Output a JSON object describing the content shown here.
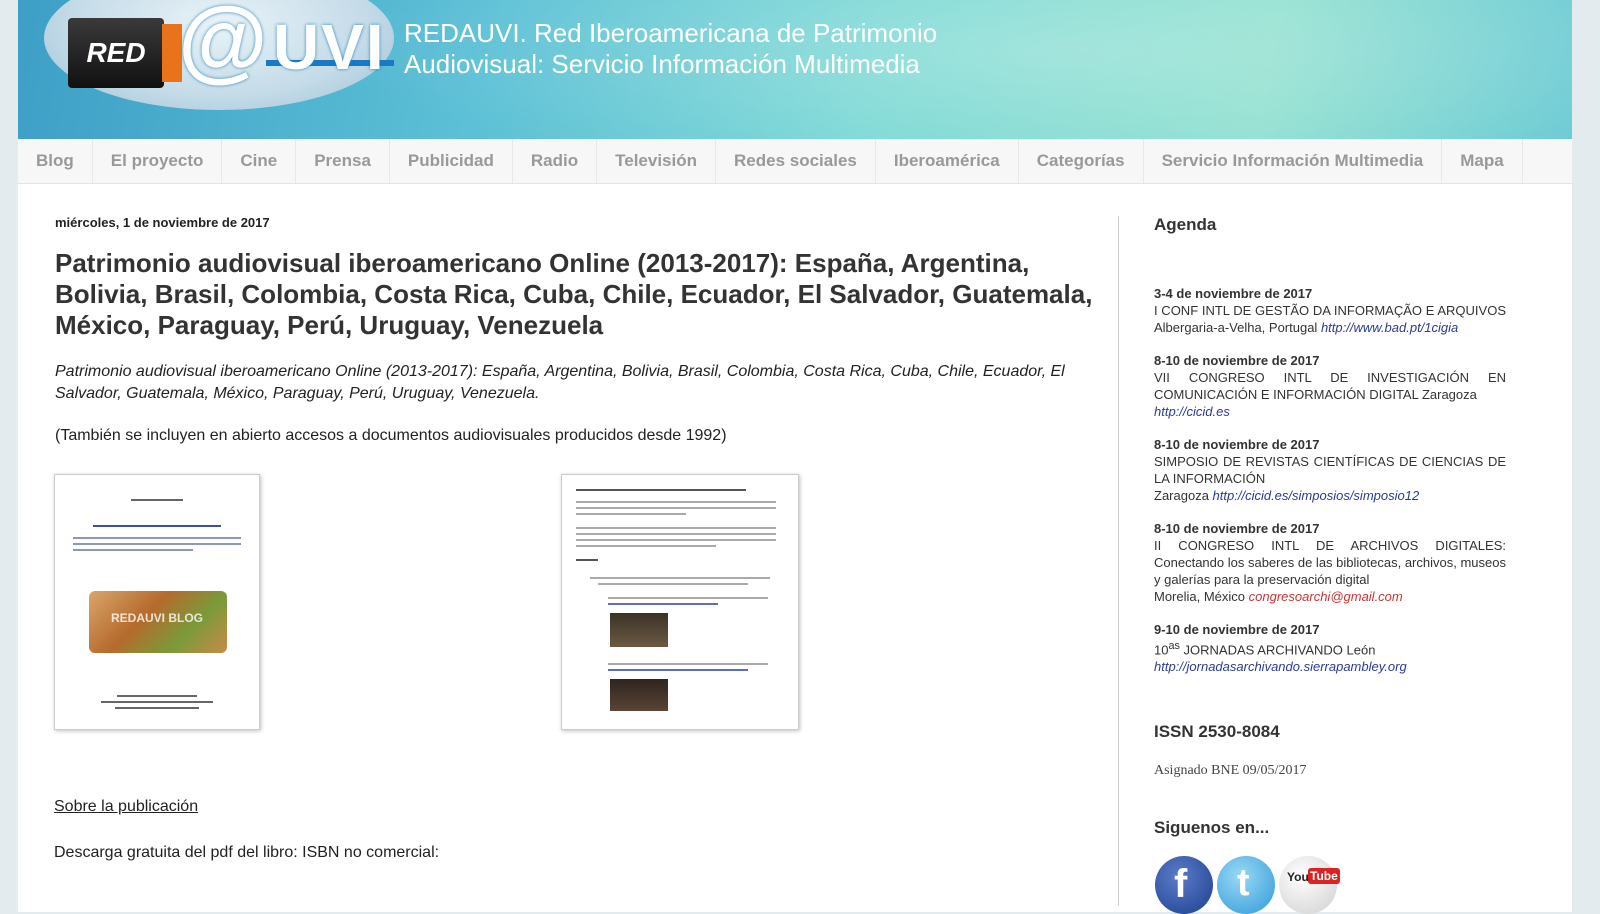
{
  "header": {
    "logo_red": "RED",
    "logo_at": "@",
    "logo_uvi": "UVI",
    "title_line1": "REDAUVI. Red Iberoamericana de Patrimonio",
    "title_line2": "Audiovisual: Servicio Información Multimedia"
  },
  "nav": {
    "items": [
      "Blog",
      "El proyecto",
      "Cine",
      "Prensa",
      "Publicidad",
      "Radio",
      "Televisión",
      "Redes sociales",
      "Iberoamérica",
      "Categorías",
      "Servicio Información Multimedia",
      "Mapa"
    ]
  },
  "post": {
    "date": "miércoles, 1 de noviembre de 2017",
    "title": "Patrimonio audiovisual iberoamericano Online (2013-2017): España, Argentina, Bolivia, Brasil, Colombia, Costa Rica, Cuba, Chile, Ecuador, El Salvador, Guatemala, México, Paraguay, Perú, Uruguay, Venezuela",
    "intro": "Patrimonio audiovisual iberoamericano Online (2013-2017): España, Argentina, Bolivia, Brasil, Colombia, Costa Rica, Cuba, Chile, Ecuador, El Salvador, Guatemala, México, Paraguay, Perú, Uruguay, Venezuela.",
    "note": "(También se incluyen en abierto accesos a documentos audiovisuales producidos desde 1992)",
    "thumb1_watermark": "REDAUVI BLOG",
    "about_link": "Sobre la publicación",
    "download_text": "Descarga gratuita del pdf del libro: ISBN no comercial:"
  },
  "sidebar": {
    "agenda_title": "Agenda",
    "events": [
      {
        "date": "3-4 de noviembre de 2017",
        "text": "I CONF INTL DE GESTÃO DA INFORMAÇÃO E ARQUIVOS Albergaria-a-Velha, Portugal",
        "link": "http://www.bad.pt/1cigia"
      },
      {
        "date": "8-10 de noviembre de 2017",
        "text": "VII CONGRESO INTL DE INVESTIGACIÓN EN COMUNICACIÓN E INFORMACIÓN DIGITAL Zaragoza",
        "link": "http://cicid.es"
      },
      {
        "date": "8-10 de noviembre de 2017",
        "text": "SIMPOSIO DE REVISTAS CIENTÍFICAS DE CIENCIAS DE LA INFORMACIÓN",
        "text2": "Zaragoza",
        "link": "http://cicid.es/simposios/simposio12"
      },
      {
        "date": "8-10 de noviembre de 2017",
        "text": "II CONGRESO INTL DE ARCHIVOS DIGITALES: Conectando los saberes de las bibliotecas, archivos, museos y galerías para la preservación digital",
        "text2": "Morelia, México",
        "link": "congresoarchi@gmail.com"
      },
      {
        "date": "9-10 de noviembre de 2017",
        "prefix": "10",
        "sup": "as",
        "text": " JORNADAS ARCHIVANDO León",
        "link": "http://jornadasarchivando.sierrapambley.org"
      }
    ],
    "issn_title": "ISSN 2530-8084",
    "issn_note": "Asignado BNE 09/05/2017",
    "follow_title": "Siguenos en..."
  },
  "colors": {
    "nav_text": "#999999",
    "link_blue": "#2a3b9a",
    "link_red": "#cc3333"
  }
}
